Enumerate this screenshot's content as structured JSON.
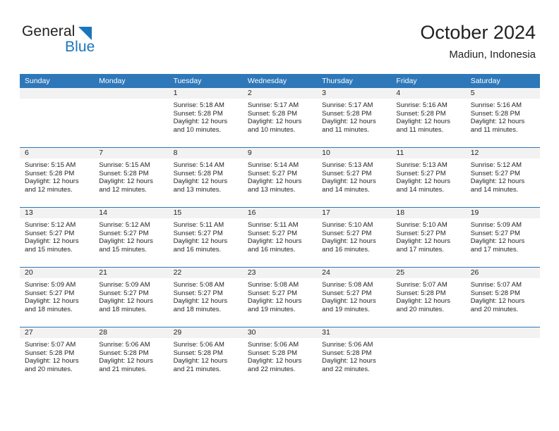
{
  "brand": {
    "general": "General",
    "blue": "Blue",
    "triangle_color": "#1b75bb"
  },
  "header": {
    "title": "October 2024",
    "subtitle": "Madiun, Indonesia"
  },
  "theme": {
    "header_blue": "#2e78b9",
    "daynum_band": "#f2f2f2",
    "text": "#231f20"
  },
  "weekday_headers": [
    "Sunday",
    "Monday",
    "Tuesday",
    "Wednesday",
    "Thursday",
    "Friday",
    "Saturday"
  ],
  "weeks": [
    [
      {
        "day": "",
        "empty": true
      },
      {
        "day": "",
        "empty": true
      },
      {
        "day": "1",
        "sunrise": "Sunrise: 5:18 AM",
        "sunset": "Sunset: 5:28 PM",
        "daylight": "Daylight: 12 hours and 10 minutes."
      },
      {
        "day": "2",
        "sunrise": "Sunrise: 5:17 AM",
        "sunset": "Sunset: 5:28 PM",
        "daylight": "Daylight: 12 hours and 10 minutes."
      },
      {
        "day": "3",
        "sunrise": "Sunrise: 5:17 AM",
        "sunset": "Sunset: 5:28 PM",
        "daylight": "Daylight: 12 hours and 11 minutes."
      },
      {
        "day": "4",
        "sunrise": "Sunrise: 5:16 AM",
        "sunset": "Sunset: 5:28 PM",
        "daylight": "Daylight: 12 hours and 11 minutes."
      },
      {
        "day": "5",
        "sunrise": "Sunrise: 5:16 AM",
        "sunset": "Sunset: 5:28 PM",
        "daylight": "Daylight: 12 hours and 11 minutes."
      }
    ],
    [
      {
        "day": "6",
        "sunrise": "Sunrise: 5:15 AM",
        "sunset": "Sunset: 5:28 PM",
        "daylight": "Daylight: 12 hours and 12 minutes."
      },
      {
        "day": "7",
        "sunrise": "Sunrise: 5:15 AM",
        "sunset": "Sunset: 5:28 PM",
        "daylight": "Daylight: 12 hours and 12 minutes."
      },
      {
        "day": "8",
        "sunrise": "Sunrise: 5:14 AM",
        "sunset": "Sunset: 5:28 PM",
        "daylight": "Daylight: 12 hours and 13 minutes."
      },
      {
        "day": "9",
        "sunrise": "Sunrise: 5:14 AM",
        "sunset": "Sunset: 5:27 PM",
        "daylight": "Daylight: 12 hours and 13 minutes."
      },
      {
        "day": "10",
        "sunrise": "Sunrise: 5:13 AM",
        "sunset": "Sunset: 5:27 PM",
        "daylight": "Daylight: 12 hours and 14 minutes."
      },
      {
        "day": "11",
        "sunrise": "Sunrise: 5:13 AM",
        "sunset": "Sunset: 5:27 PM",
        "daylight": "Daylight: 12 hours and 14 minutes."
      },
      {
        "day": "12",
        "sunrise": "Sunrise: 5:12 AM",
        "sunset": "Sunset: 5:27 PM",
        "daylight": "Daylight: 12 hours and 14 minutes."
      }
    ],
    [
      {
        "day": "13",
        "sunrise": "Sunrise: 5:12 AM",
        "sunset": "Sunset: 5:27 PM",
        "daylight": "Daylight: 12 hours and 15 minutes."
      },
      {
        "day": "14",
        "sunrise": "Sunrise: 5:12 AM",
        "sunset": "Sunset: 5:27 PM",
        "daylight": "Daylight: 12 hours and 15 minutes."
      },
      {
        "day": "15",
        "sunrise": "Sunrise: 5:11 AM",
        "sunset": "Sunset: 5:27 PM",
        "daylight": "Daylight: 12 hours and 16 minutes."
      },
      {
        "day": "16",
        "sunrise": "Sunrise: 5:11 AM",
        "sunset": "Sunset: 5:27 PM",
        "daylight": "Daylight: 12 hours and 16 minutes."
      },
      {
        "day": "17",
        "sunrise": "Sunrise: 5:10 AM",
        "sunset": "Sunset: 5:27 PM",
        "daylight": "Daylight: 12 hours and 16 minutes."
      },
      {
        "day": "18",
        "sunrise": "Sunrise: 5:10 AM",
        "sunset": "Sunset: 5:27 PM",
        "daylight": "Daylight: 12 hours and 17 minutes."
      },
      {
        "day": "19",
        "sunrise": "Sunrise: 5:09 AM",
        "sunset": "Sunset: 5:27 PM",
        "daylight": "Daylight: 12 hours and 17 minutes."
      }
    ],
    [
      {
        "day": "20",
        "sunrise": "Sunrise: 5:09 AM",
        "sunset": "Sunset: 5:27 PM",
        "daylight": "Daylight: 12 hours and 18 minutes."
      },
      {
        "day": "21",
        "sunrise": "Sunrise: 5:09 AM",
        "sunset": "Sunset: 5:27 PM",
        "daylight": "Daylight: 12 hours and 18 minutes."
      },
      {
        "day": "22",
        "sunrise": "Sunrise: 5:08 AM",
        "sunset": "Sunset: 5:27 PM",
        "daylight": "Daylight: 12 hours and 18 minutes."
      },
      {
        "day": "23",
        "sunrise": "Sunrise: 5:08 AM",
        "sunset": "Sunset: 5:27 PM",
        "daylight": "Daylight: 12 hours and 19 minutes."
      },
      {
        "day": "24",
        "sunrise": "Sunrise: 5:08 AM",
        "sunset": "Sunset: 5:27 PM",
        "daylight": "Daylight: 12 hours and 19 minutes."
      },
      {
        "day": "25",
        "sunrise": "Sunrise: 5:07 AM",
        "sunset": "Sunset: 5:28 PM",
        "daylight": "Daylight: 12 hours and 20 minutes."
      },
      {
        "day": "26",
        "sunrise": "Sunrise: 5:07 AM",
        "sunset": "Sunset: 5:28 PM",
        "daylight": "Daylight: 12 hours and 20 minutes."
      }
    ],
    [
      {
        "day": "27",
        "sunrise": "Sunrise: 5:07 AM",
        "sunset": "Sunset: 5:28 PM",
        "daylight": "Daylight: 12 hours and 20 minutes."
      },
      {
        "day": "28",
        "sunrise": "Sunrise: 5:06 AM",
        "sunset": "Sunset: 5:28 PM",
        "daylight": "Daylight: 12 hours and 21 minutes."
      },
      {
        "day": "29",
        "sunrise": "Sunrise: 5:06 AM",
        "sunset": "Sunset: 5:28 PM",
        "daylight": "Daylight: 12 hours and 21 minutes."
      },
      {
        "day": "30",
        "sunrise": "Sunrise: 5:06 AM",
        "sunset": "Sunset: 5:28 PM",
        "daylight": "Daylight: 12 hours and 22 minutes."
      },
      {
        "day": "31",
        "sunrise": "Sunrise: 5:06 AM",
        "sunset": "Sunset: 5:28 PM",
        "daylight": "Daylight: 12 hours and 22 minutes."
      },
      {
        "day": "",
        "empty": true
      },
      {
        "day": "",
        "empty": true
      }
    ]
  ]
}
